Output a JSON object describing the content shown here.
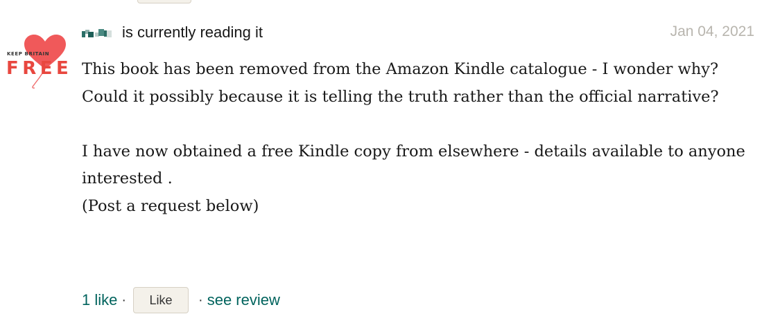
{
  "post": {
    "status_text": "is currently reading it",
    "date": "Jan 04, 2021",
    "avatar": {
      "text_top": "KEEP BRITAIN",
      "text_main": "FREE",
      "heart_color": "#f0595a",
      "text_color": "#e8473f"
    },
    "review_lines": [
      "This book has been removed from the Amazon Kindle catalogue - I wonder why?",
      "Could it possibly because it is telling the truth rather than the official narrative?",
      "",
      "I have now obtained a free Kindle copy from elsewhere - details available to anyone interested .",
      "(Post a request below)"
    ],
    "actions": {
      "likes_label": "1 like",
      "separator": "·",
      "like_button_label": "Like",
      "see_review_label": "see review"
    }
  },
  "colors": {
    "link": "#00635d",
    "date": "#b8b5ae",
    "button_bg": "#f4f1ea",
    "button_border": "#d6d0c4"
  }
}
